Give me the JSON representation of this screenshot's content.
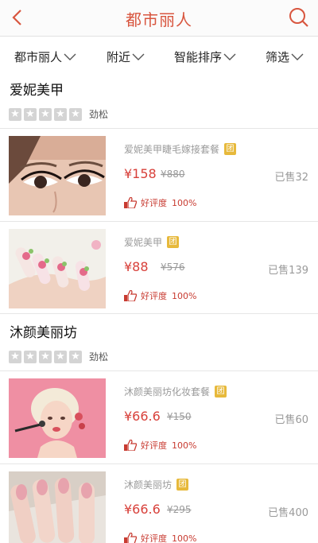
{
  "header": {
    "title": "都市丽人",
    "back_icon": "chevron-left-icon",
    "search_icon": "search-icon",
    "accent_color": "#d8563f"
  },
  "filters": [
    {
      "label": "都市丽人"
    },
    {
      "label": "附近"
    },
    {
      "label": "智能排序"
    },
    {
      "label": "筛选"
    }
  ],
  "shops": [
    {
      "name": "爱妮美甲",
      "rating_text": "劲松",
      "stars": 0,
      "deals": [
        {
          "title": "爱妮美甲睫毛嫁接套餐",
          "tag": "团",
          "price": "¥158",
          "original_price": "¥880",
          "sold": "已售32",
          "praise_label": "好评度",
          "praise_value": "100%"
        },
        {
          "title": "爱妮美甲",
          "tag": "团",
          "price": "¥88",
          "original_price": "¥576",
          "sold": "已售139",
          "praise_label": "好评度",
          "praise_value": "100%"
        }
      ]
    },
    {
      "name": "沐颜美丽坊",
      "rating_text": "劲松",
      "stars": 0,
      "deals": [
        {
          "title": "沐颜美丽坊化妆套餐",
          "tag": "团",
          "price": "¥66.6",
          "original_price": "¥150",
          "sold": "已售60",
          "praise_label": "好评度",
          "praise_value": "100%"
        },
        {
          "title": "沐颜美丽坊",
          "tag": "团",
          "price": "¥66.6",
          "original_price": "¥295",
          "sold": "已售400",
          "praise_label": "好评度",
          "praise_value": "100%"
        }
      ]
    }
  ]
}
